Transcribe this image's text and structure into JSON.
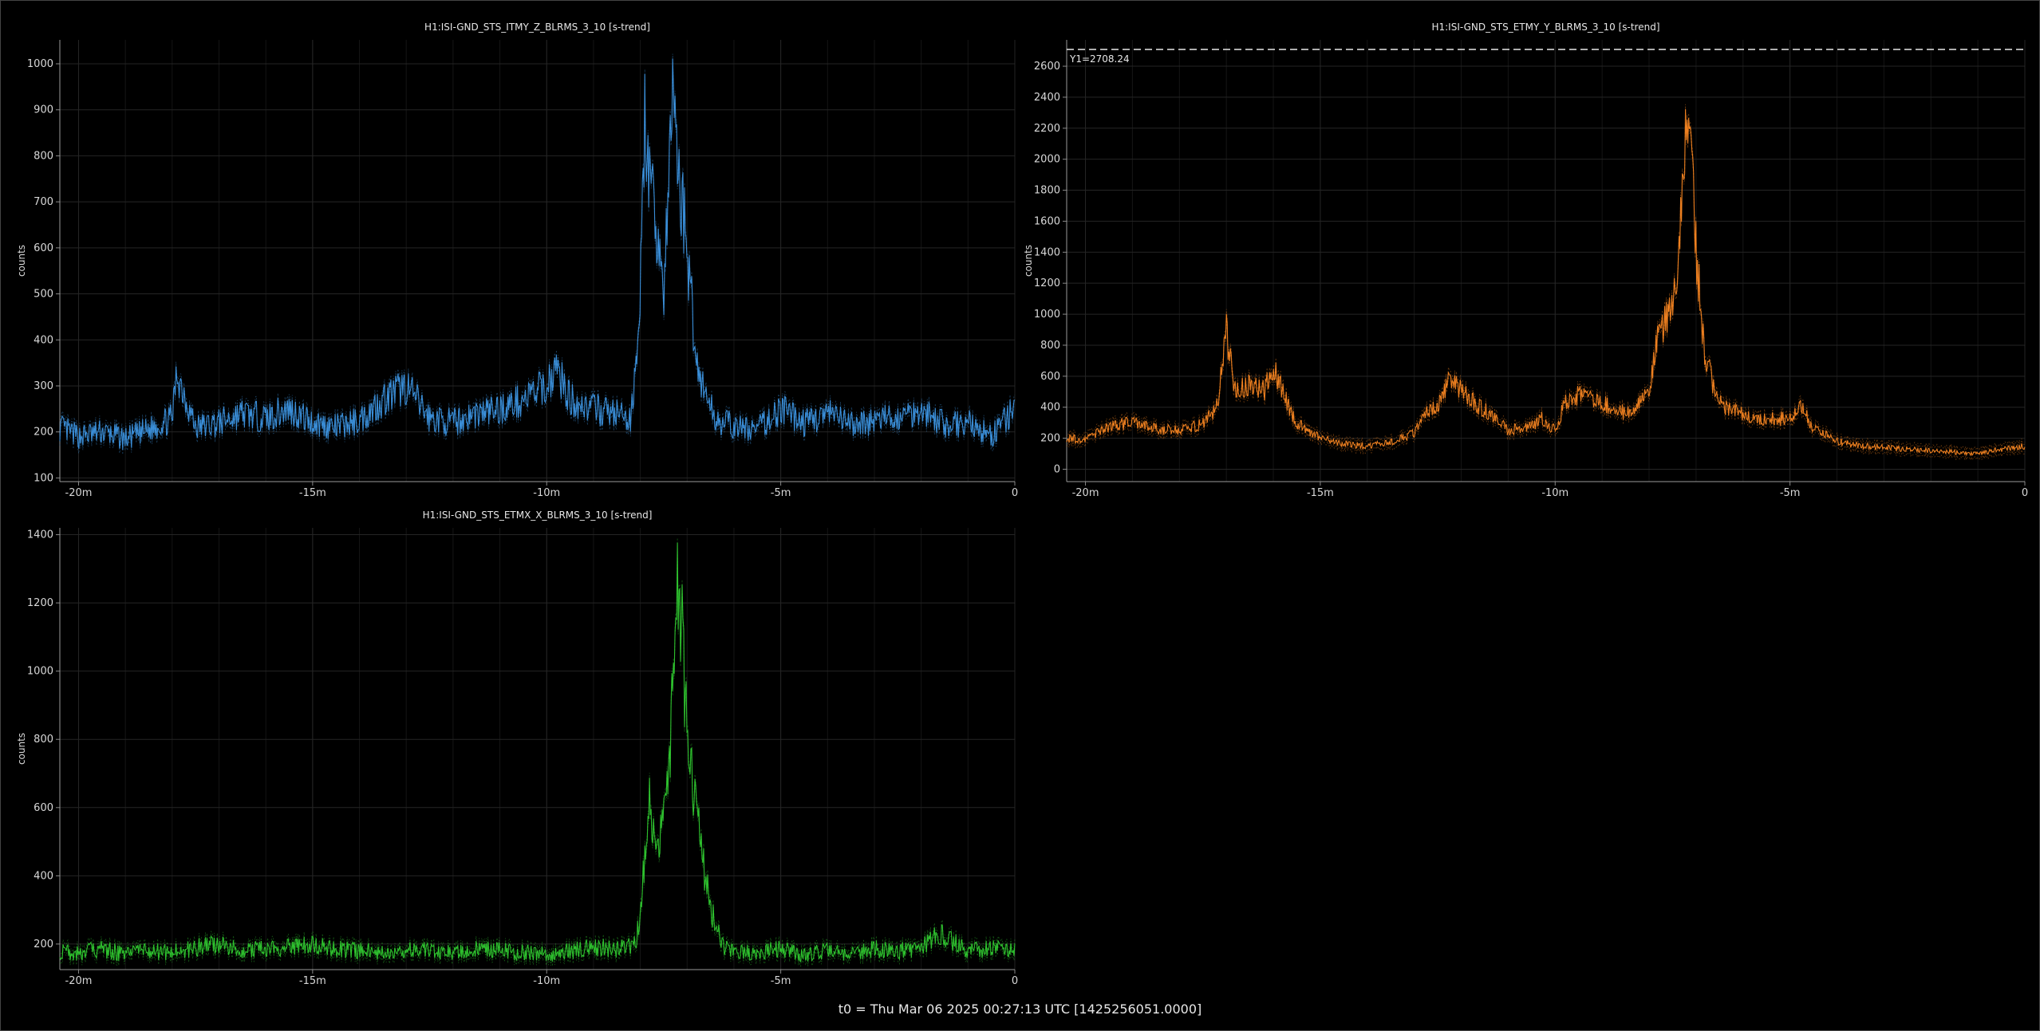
{
  "footer": "t0 = Thu Mar 06 2025 00:27:13 UTC [1425256051.0000]",
  "chart_data": [
    {
      "type": "line",
      "title": "H1:ISI-GND_STS_ITMY_Z_BLRMS_3_10 [s-trend]",
      "xlabel": "",
      "ylabel": "counts",
      "color": "#3a8ed8",
      "xlim": [
        -20.4,
        0
      ],
      "ylim": [
        92,
        1052
      ],
      "xticks": [
        -20,
        -15,
        -10,
        -5,
        0
      ],
      "xtick_labels": [
        "-20m",
        "-15m",
        "-10m",
        "-5m",
        "0"
      ],
      "yticks": [
        100,
        200,
        300,
        400,
        500,
        600,
        700,
        800,
        900,
        1000
      ],
      "grid": true,
      "x": [
        -20.4,
        -20.0,
        -19.5,
        -19.0,
        -18.5,
        -18.0,
        -17.9,
        -17.5,
        -17.0,
        -16.5,
        -16.0,
        -15.5,
        -15.0,
        -14.5,
        -14.0,
        -13.5,
        -13.0,
        -12.5,
        -12.0,
        -11.5,
        -11.0,
        -10.5,
        -10.0,
        -9.8,
        -9.5,
        -9.0,
        -8.5,
        -8.2,
        -8.0,
        -7.9,
        -7.8,
        -7.6,
        -7.5,
        -7.4,
        -7.3,
        -7.2,
        -7.0,
        -6.8,
        -6.6,
        -6.4,
        -6.2,
        -6.0,
        -5.5,
        -5.0,
        -4.5,
        -4.0,
        -3.5,
        -3.0,
        -2.5,
        -2.0,
        -1.5,
        -1.0,
        -0.5,
        0.0
      ],
      "y": [
        210,
        190,
        200,
        185,
        205,
        230,
        330,
        210,
        220,
        240,
        230,
        250,
        220,
        210,
        225,
        270,
        300,
        230,
        220,
        240,
        250,
        270,
        300,
        340,
        270,
        250,
        240,
        220,
        500,
        900,
        720,
        620,
        500,
        700,
        980,
        780,
        600,
        350,
        280,
        230,
        220,
        210,
        205,
        250,
        220,
        240,
        215,
        225,
        230,
        250,
        215,
        220,
        190,
        250
      ]
    },
    {
      "type": "line",
      "title": "H1:ISI-GND_STS_ETMY_Y_BLRMS_3_10 [s-trend]",
      "xlabel": "",
      "ylabel": "counts",
      "color": "#ee8020",
      "xlim": [
        -20.4,
        0
      ],
      "ylim": [
        -80,
        2770
      ],
      "xticks": [
        -20,
        -15,
        -10,
        -5,
        0
      ],
      "xtick_labels": [
        "-20m",
        "-15m",
        "-10m",
        "-5m",
        "0"
      ],
      "yticks": [
        0,
        200,
        400,
        600,
        800,
        1000,
        1200,
        1400,
        1600,
        1800,
        2000,
        2200,
        2400,
        2600
      ],
      "grid": true,
      "annotation": {
        "label": "Y1=2708.24",
        "y": 2708.24,
        "style": "dashed"
      },
      "x": [
        -20.4,
        -20.0,
        -19.5,
        -19.0,
        -18.5,
        -18.0,
        -17.5,
        -17.2,
        -17.0,
        -16.8,
        -16.5,
        -16.2,
        -16.0,
        -15.7,
        -15.5,
        -15.0,
        -14.5,
        -14.0,
        -13.5,
        -13.0,
        -12.8,
        -12.5,
        -12.2,
        -12.0,
        -11.5,
        -11.0,
        -10.5,
        -10.3,
        -10.0,
        -9.8,
        -9.5,
        -9.0,
        -8.5,
        -8.0,
        -7.8,
        -7.6,
        -7.4,
        -7.2,
        -7.0,
        -6.8,
        -6.5,
        -6.2,
        -6.0,
        -5.5,
        -5.0,
        -4.8,
        -4.5,
        -4.0,
        -3.5,
        -3.0,
        -2.5,
        -2.0,
        -1.5,
        -1.0,
        -0.5,
        0.0
      ],
      "y": [
        200,
        190,
        280,
        300,
        260,
        250,
        290,
        400,
        880,
        480,
        560,
        500,
        650,
        420,
        300,
        200,
        160,
        150,
        170,
        230,
        350,
        420,
        600,
        500,
        380,
        250,
        280,
        330,
        250,
        420,
        480,
        430,
        360,
        500,
        900,
        1000,
        1300,
        2450,
        1400,
        700,
        420,
        380,
        350,
        320,
        330,
        420,
        260,
        180,
        150,
        140,
        130,
        120,
        110,
        100,
        130,
        150
      ]
    },
    {
      "type": "line",
      "title": "H1:ISI-GND_STS_ETMX_X_BLRMS_3_10 [s-trend]",
      "xlabel": "",
      "ylabel": "counts",
      "color": "#2ec12e",
      "xlim": [
        -20.4,
        0
      ],
      "ylim": [
        125,
        1420
      ],
      "xticks": [
        -20,
        -15,
        -10,
        -5,
        0
      ],
      "xtick_labels": [
        "-20m",
        "-15m",
        "-10m",
        "-5m",
        "0"
      ],
      "yticks": [
        200,
        400,
        600,
        800,
        1000,
        1200,
        1400
      ],
      "grid": true,
      "x": [
        -20.4,
        -20.0,
        -19.5,
        -19.0,
        -18.5,
        -18.0,
        -17.5,
        -17.0,
        -16.5,
        -16.0,
        -15.5,
        -15.0,
        -14.5,
        -14.0,
        -13.5,
        -13.0,
        -12.5,
        -12.0,
        -11.5,
        -11.0,
        -10.5,
        -10.0,
        -9.5,
        -9.0,
        -8.5,
        -8.1,
        -8.0,
        -7.8,
        -7.6,
        -7.4,
        -7.3,
        -7.2,
        -7.1,
        -7.0,
        -6.8,
        -6.6,
        -6.4,
        -6.2,
        -6.0,
        -5.5,
        -5.0,
        -4.5,
        -4.0,
        -3.5,
        -3.0,
        -2.5,
        -2.0,
        -1.6,
        -1.0,
        -0.5,
        0.0
      ],
      "y": [
        180,
        175,
        185,
        170,
        180,
        175,
        190,
        200,
        180,
        185,
        190,
        200,
        185,
        180,
        175,
        185,
        180,
        175,
        185,
        180,
        175,
        170,
        180,
        190,
        185,
        200,
        300,
        620,
        480,
        650,
        1000,
        1250,
        1100,
        800,
        600,
        380,
        250,
        190,
        180,
        175,
        185,
        170,
        180,
        175,
        185,
        180,
        190,
        230,
        180,
        185,
        180
      ]
    }
  ]
}
